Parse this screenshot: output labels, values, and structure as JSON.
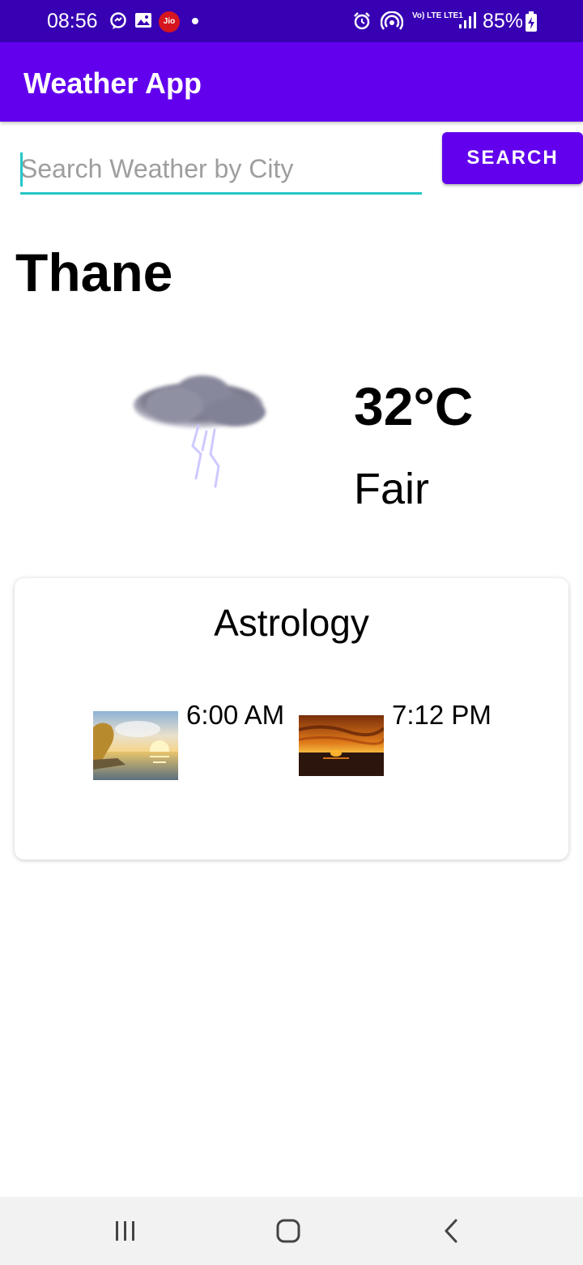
{
  "status_bar": {
    "time": "08:56",
    "battery": "85%",
    "carrier_badge": "Jio",
    "network_label": "Vo) LTE LTE1",
    "icons": [
      "messenger-icon",
      "gallery-icon",
      "jio-icon",
      "notification-dot",
      "alarm-icon",
      "hotspot-icon",
      "volte-icon",
      "signal-icon",
      "battery-charging-icon"
    ]
  },
  "app_bar": {
    "title": "Weather App"
  },
  "search": {
    "placeholder": "Search Weather by City",
    "value": "",
    "button_label": "SEARCH"
  },
  "weather": {
    "city": "Thane",
    "temperature": "32°C",
    "condition": "Fair",
    "icon": "thunderstorm-icon"
  },
  "astrology": {
    "title": "Astrology",
    "sunrise": {
      "time": "6:00 AM",
      "icon": "sunrise-image"
    },
    "sunset": {
      "time": "7:12 PM",
      "icon": "sunset-image"
    }
  },
  "nav_bar": {
    "icons": [
      "recents-icon",
      "home-icon",
      "back-icon"
    ]
  },
  "colors": {
    "status_bar": "#3700b3",
    "primary": "#6200ee",
    "accent": "#26c6c6",
    "nav_bar": "#f2f2f2"
  }
}
